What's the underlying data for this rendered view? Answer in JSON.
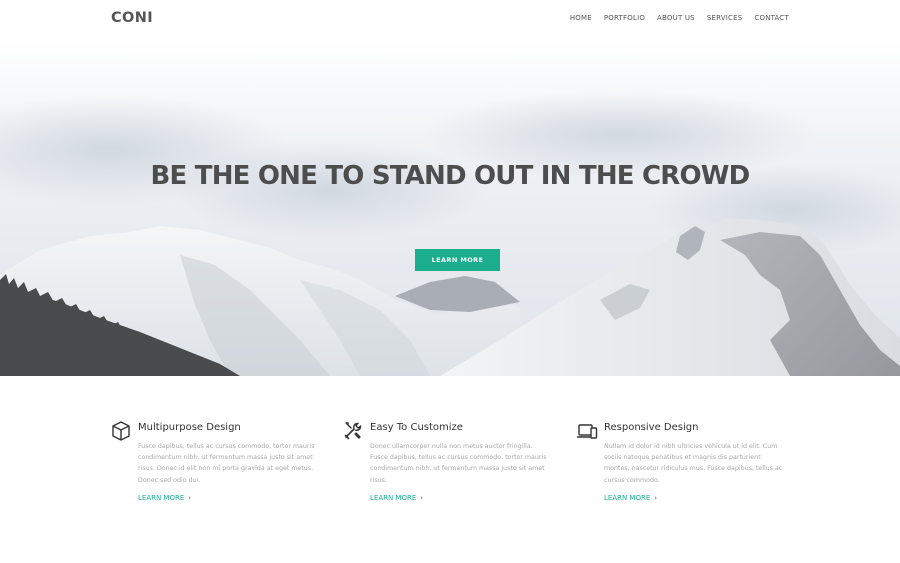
{
  "brand": {
    "logo": "CONI"
  },
  "nav": {
    "items": [
      "HOME",
      "PORTFOLIO",
      "ABOUT US",
      "SERVICES",
      "CONTACT"
    ]
  },
  "hero": {
    "title": "BE THE ONE TO STAND OUT IN THE CROWD",
    "button_label": "LEARN MORE"
  },
  "features": [
    {
      "icon": "cube-icon",
      "title": "Multipurpose Design",
      "text": "Fusce dapibus, tellus ac cursus commodo, tortor mauris condimentum nibh, ut fermentum massa justo sit amet risus. Donec id elit non mi porta gravida at eget metus. Donec sed odio dui.",
      "link": "LEARN MORE"
    },
    {
      "icon": "tools-icon",
      "title": "Easy To Customize",
      "text": "Donec ullamcorper nulla non metus auctor fringilla. Fusce dapibus, tellus ac cursus commodo, tortor mauris condimentum nibh, ut fermentum massa justo sit amet risus.",
      "link": "LEARN MORE"
    },
    {
      "icon": "devices-icon",
      "title": "Responsive Design",
      "text": "Nullam id dolor id nibh ultricies vehicula ut id elit. Cum sociis natoque penatibus et magnis dis parturient montes, nascetur ridiculus mus. Fusce dapibus, tellus ac cursus commodo.",
      "link": "LEARN MORE"
    }
  ],
  "colors": {
    "accent": "#1aae8f",
    "title": "#4d4d4d",
    "body_text": "#a7a7a7"
  }
}
